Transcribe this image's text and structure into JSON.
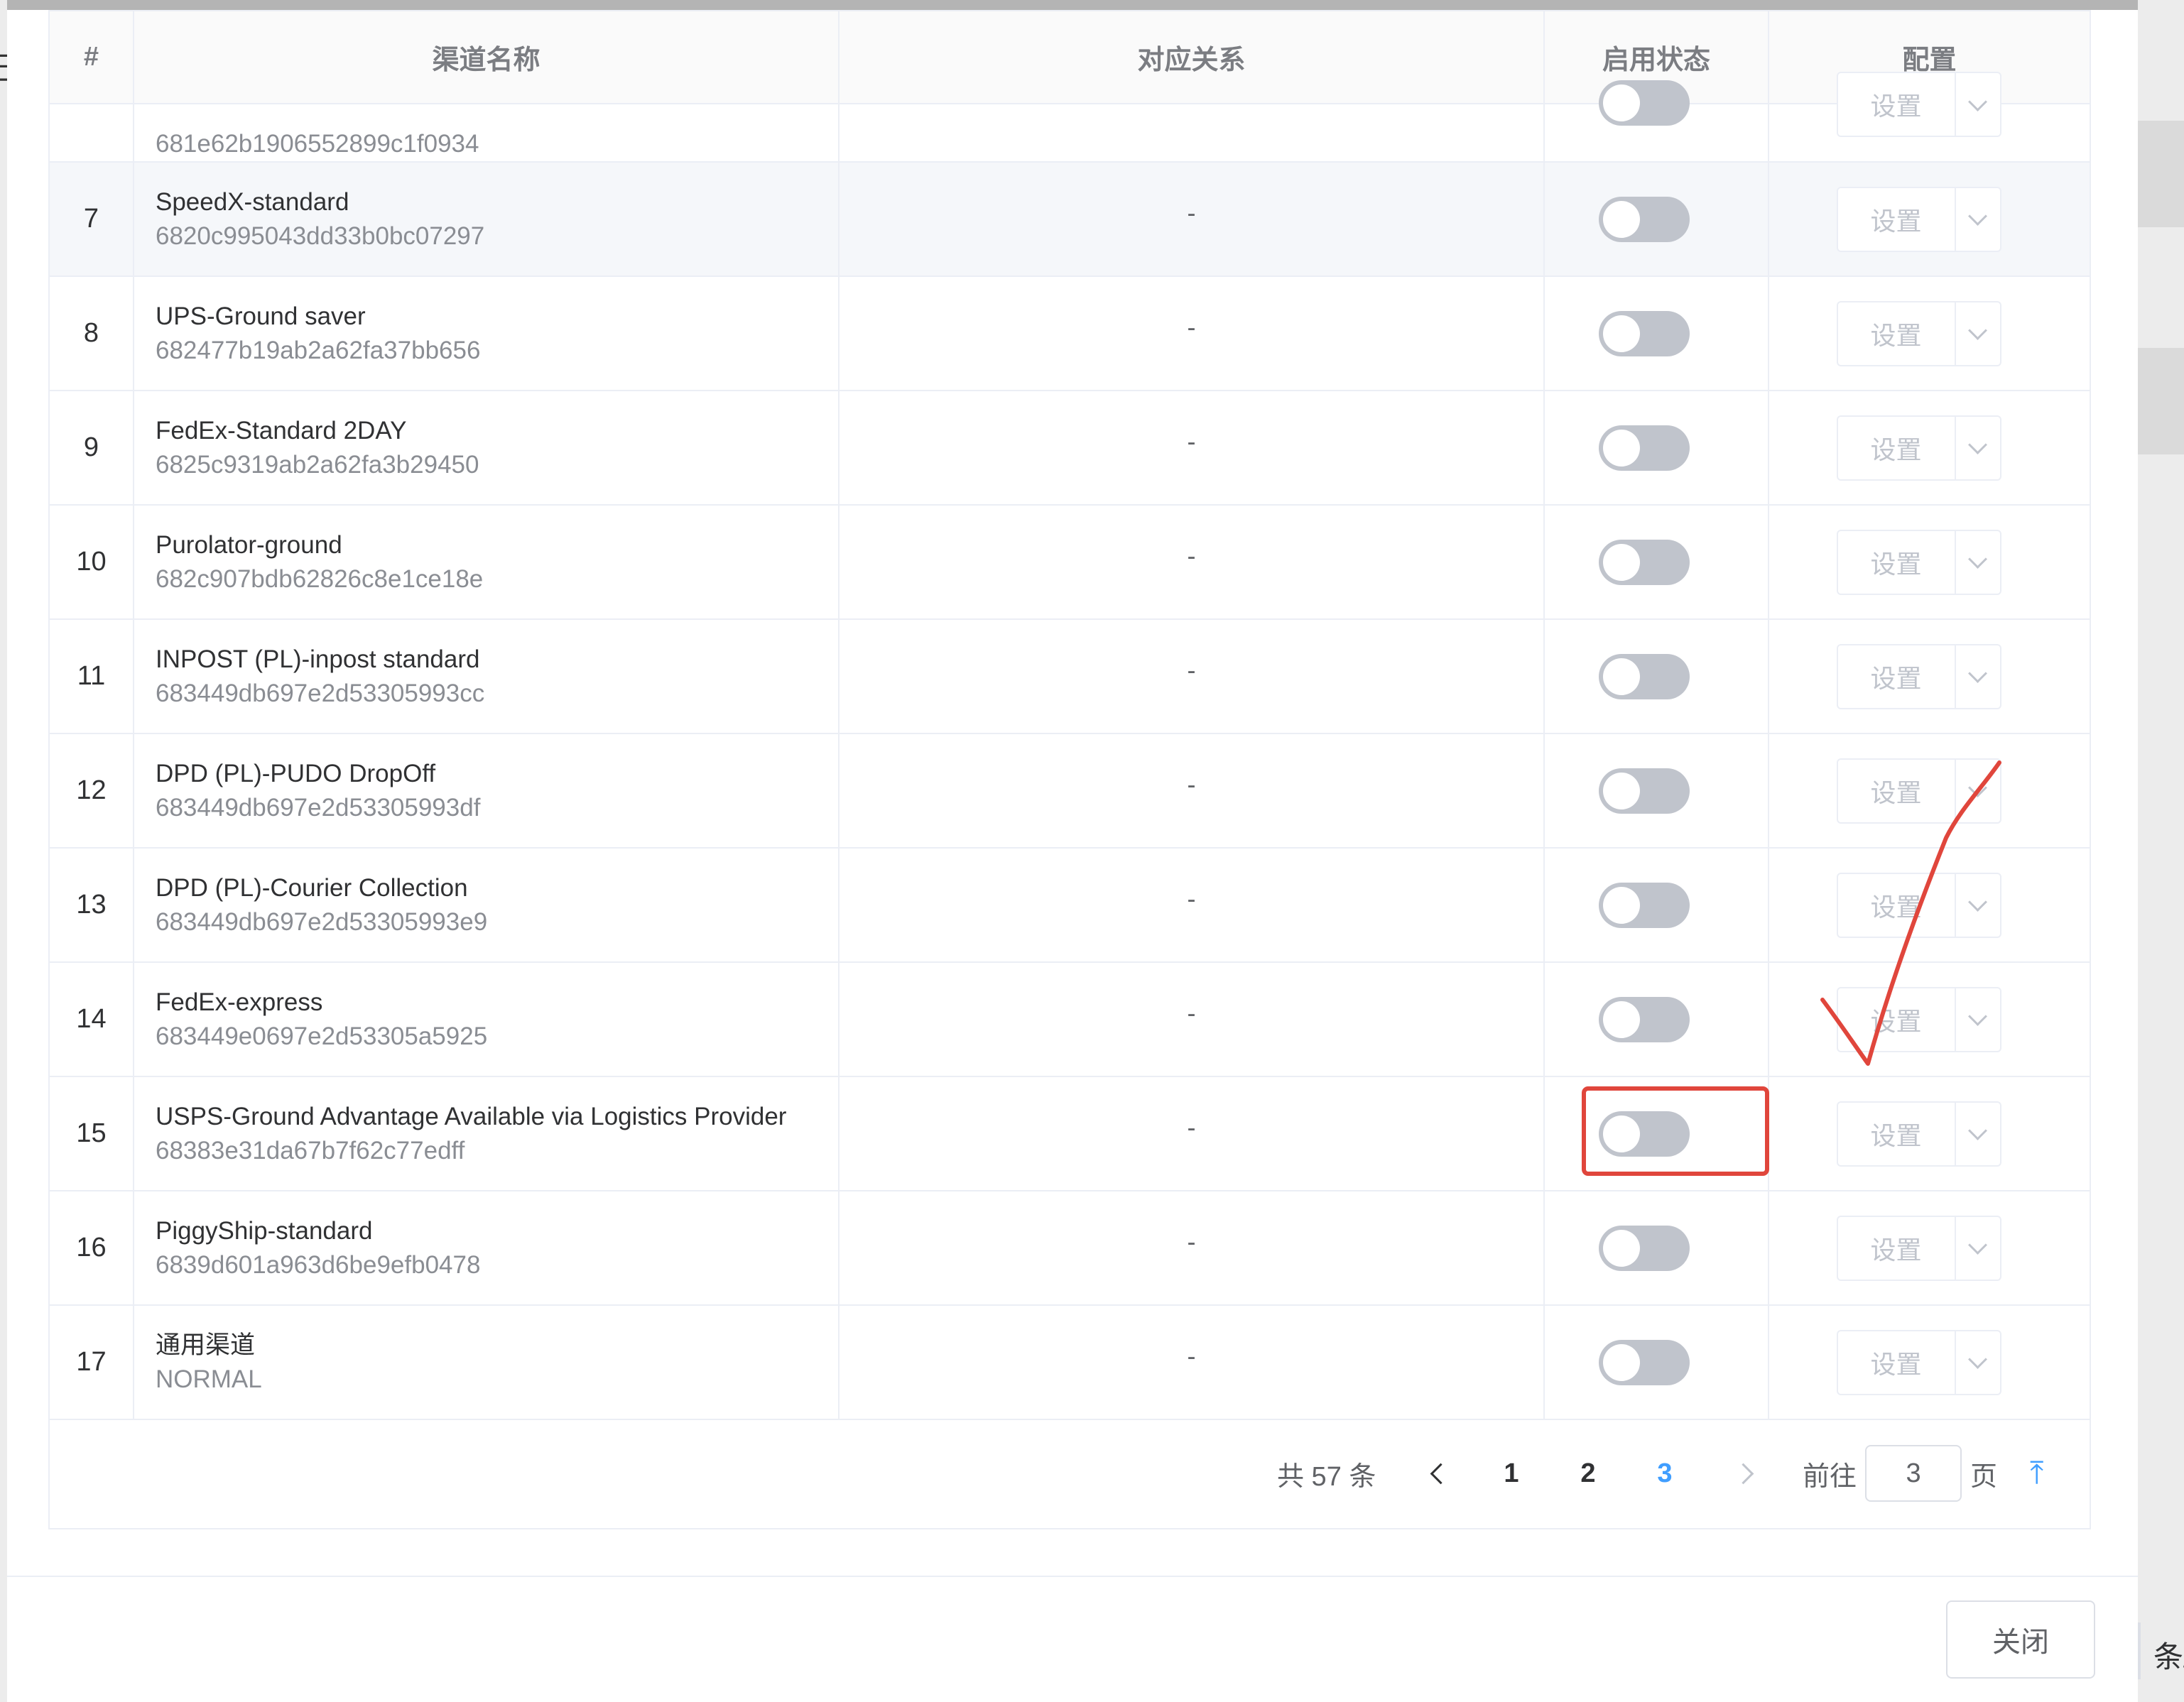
{
  "colors": {
    "accent": "#409eff",
    "annotation_red": "#e0463c",
    "switch_off": "#c0c4cc"
  },
  "background": {
    "left_fragment": "已",
    "right_fragment": "条/"
  },
  "table": {
    "headers": {
      "index": "#",
      "channel_name": "渠道名称",
      "mapping": "对应关系",
      "enabled": "启用状态",
      "config": "配置"
    },
    "partial_row": {
      "id": "681e62b1906552899c1f0934",
      "config_label": "设置"
    },
    "rows": [
      {
        "index": "7",
        "name": "SpeedX-standard",
        "id": "6820c995043dd33b0bc07297",
        "mapping": "-",
        "enabled": false,
        "config_label": "设置"
      },
      {
        "index": "8",
        "name": "UPS-Ground saver",
        "id": "682477b19ab2a62fa37bb656",
        "mapping": "-",
        "enabled": false,
        "config_label": "设置"
      },
      {
        "index": "9",
        "name": "FedEx-Standard 2DAY",
        "id": "6825c9319ab2a62fa3b29450",
        "mapping": "-",
        "enabled": false,
        "config_label": "设置"
      },
      {
        "index": "10",
        "name": "Purolator-ground",
        "id": "682c907bdb62826c8e1ce18e",
        "mapping": "-",
        "enabled": false,
        "config_label": "设置"
      },
      {
        "index": "11",
        "name": "INPOST (PL)-inpost standard",
        "id": "683449db697e2d53305993cc",
        "mapping": "-",
        "enabled": false,
        "config_label": "设置"
      },
      {
        "index": "12",
        "name": "DPD (PL)-PUDO DropOff",
        "id": "683449db697e2d53305993df",
        "mapping": "-",
        "enabled": false,
        "config_label": "设置"
      },
      {
        "index": "13",
        "name": "DPD (PL)-Courier Collection",
        "id": "683449db697e2d53305993e9",
        "mapping": "-",
        "enabled": false,
        "config_label": "设置"
      },
      {
        "index": "14",
        "name": "FedEx-express",
        "id": "683449e0697e2d53305a5925",
        "mapping": "-",
        "enabled": false,
        "config_label": "设置"
      },
      {
        "index": "15",
        "name": "USPS-Ground Advantage Available via Logistics Provider",
        "id": "68383e31da67b7f62c77edff",
        "mapping": "-",
        "enabled": false,
        "config_label": "设置"
      },
      {
        "index": "16",
        "name": "PiggyShip-standard",
        "id": "6839d601a963d6be9efb0478",
        "mapping": "-",
        "enabled": false,
        "config_label": "设置"
      },
      {
        "index": "17",
        "name": "通用渠道",
        "id": "NORMAL",
        "mapping": "-",
        "enabled": false,
        "config_label": "设置"
      }
    ]
  },
  "pagination": {
    "total": "共 57 条",
    "pages": [
      "1",
      "2",
      "3"
    ],
    "current": "3",
    "goto_prefix": "前往",
    "goto_value": "3",
    "goto_suffix": "页"
  },
  "footer": {
    "close_label": "关闭"
  },
  "annotations": {
    "highlighted_row": "15",
    "checkmark": true
  }
}
